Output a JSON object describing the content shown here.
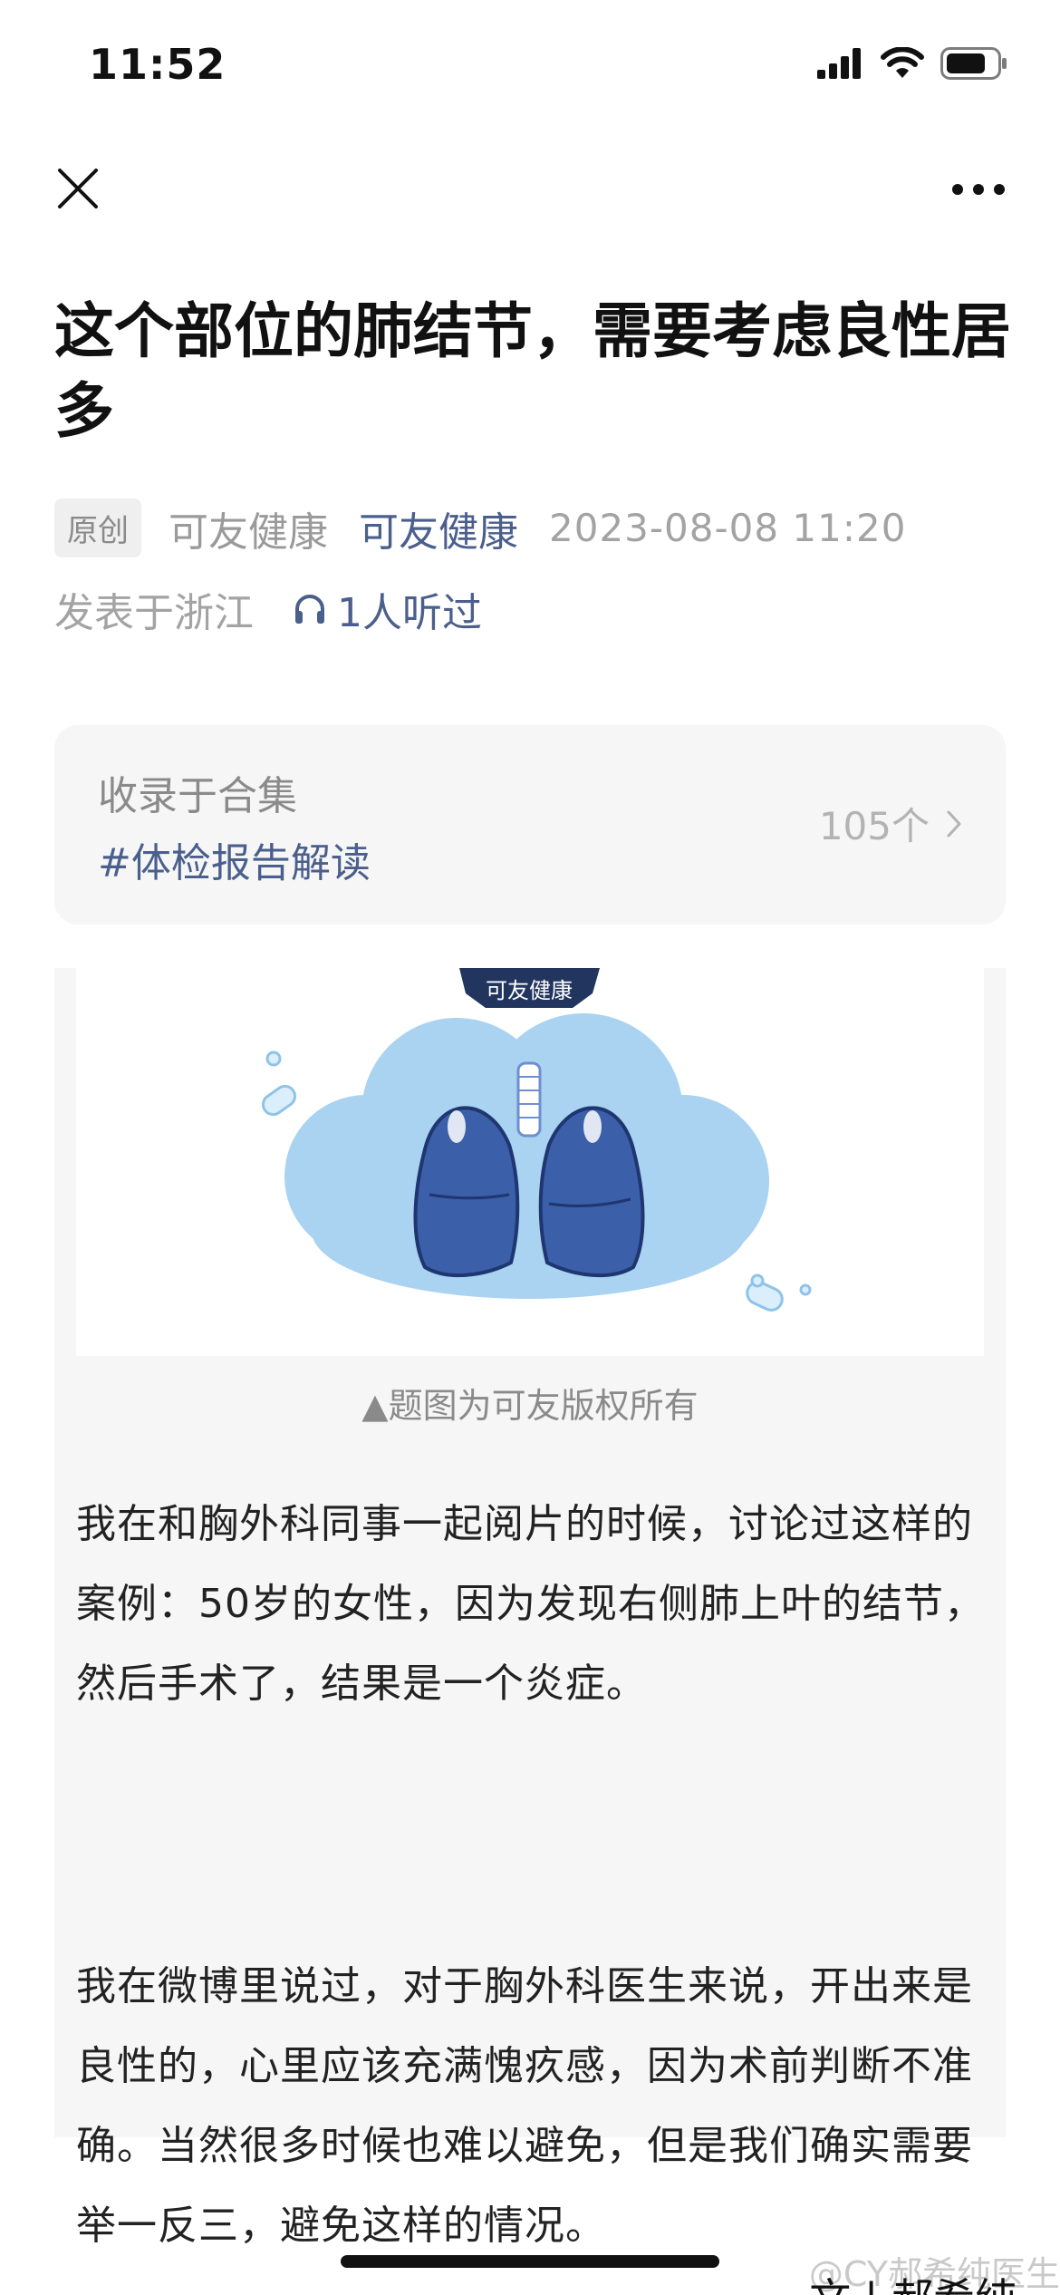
{
  "status": {
    "time": "11:52",
    "icons": [
      "signal-icon",
      "wifi-icon",
      "battery-icon"
    ]
  },
  "nav": {
    "close_icon": "close-icon",
    "more_icon": "more-icon"
  },
  "article": {
    "title": "这个部位的肺结节，需要考虑良性居多",
    "badge": "原创",
    "author": "可友健康",
    "account": "可友健康",
    "datetime": "2023-08-08 11:20",
    "location": "发表于浙江",
    "listens": "1人听过"
  },
  "collection": {
    "label": "收录于合集",
    "tag": "#体检报告解读",
    "count": "105个"
  },
  "figure": {
    "banner": "可友健康",
    "caption": "▲题图为可友版权所有"
  },
  "paragraphs": {
    "p1": "我在和胸外科同事一起阅片的时候，讨论过这样的案例：50岁的女性，因为发现右侧肺上叶的结节，然后手术了，结果是一个炎症。",
    "p2": "我在微博里说过，对于胸外科医生来说，开出来是良性的，心里应该充满愧疚感，因为术前判断不准确。当然很多时候也难以避免，但是我们确实需要举一反三，避免这样的情况。"
  },
  "footer": {
    "watermark": "@CY郝希纯医生",
    "peek": "文 | 郝希纯"
  },
  "colors": {
    "accent_link": "#4a5f8c",
    "card_bg": "#f6f6f6",
    "lung_blue": "#3b5fa8",
    "cloud_blue": "#a9d3f0"
  }
}
